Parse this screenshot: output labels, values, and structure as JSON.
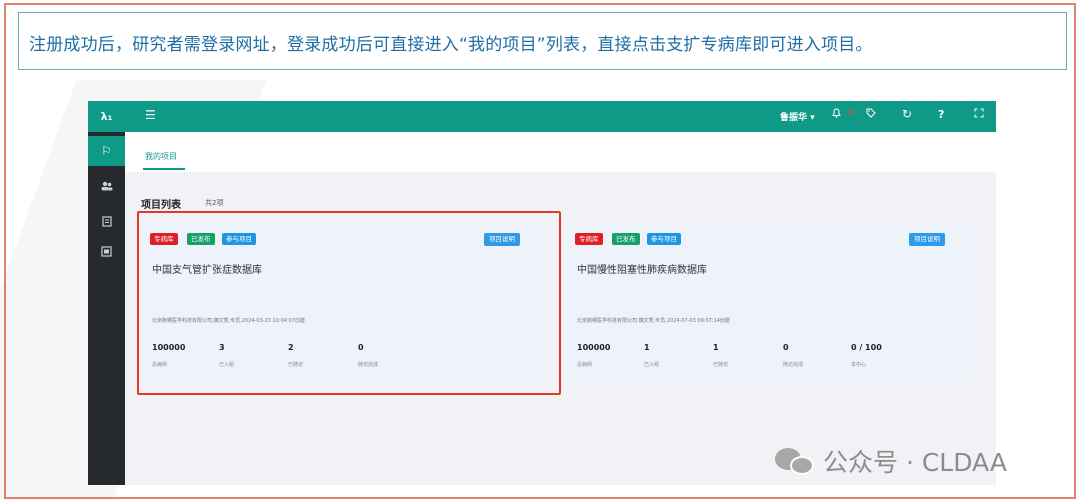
{
  "banner": {
    "text": "注册成功后，研究者需登录网址，登录成功后可直接进入“我的项目”列表，直接点击支扩专病库即可进入项目。"
  },
  "app": {
    "logo": "λ₁",
    "topbar": {
      "user_name": "鲁振华 ▾",
      "icons": [
        "menu-icon",
        "bell-icon",
        "tag-icon",
        "refresh-icon",
        "help-icon",
        "fullscreen-icon"
      ]
    },
    "sidebar": {
      "icons": [
        "flag-icon",
        "users-icon",
        "report-icon",
        "box-icon"
      ]
    },
    "tabs": [
      {
        "label": "我的项目"
      }
    ],
    "project_list": {
      "title": "项目列表",
      "count": "共2项"
    },
    "projects": [
      {
        "badges": [
          "专病库",
          "已发布",
          "参与项目"
        ],
        "desc_button": "项目说明",
        "title": "中国支气管扩张症数据库",
        "meta": "北京跑哪医学科技有限公司,魏文秀,专员,2024-03-23 10:04:07创建",
        "stats": [
          {
            "value": "100000",
            "label": "总病例"
          },
          {
            "value": "3",
            "label": "已入组"
          },
          {
            "value": "2",
            "label": "已随访"
          },
          {
            "value": "0",
            "label": "随访完成"
          }
        ]
      },
      {
        "badges": [
          "专病库",
          "已发布",
          "参与项目"
        ],
        "desc_button": "项目说明",
        "title": "中国慢性阻塞性肺疾病数据库",
        "meta": "北京跑哪医学科技有限公司,魏文秀,专员,2024-07-03 09:07:14创建",
        "stats": [
          {
            "value": "100000",
            "label": "总病例"
          },
          {
            "value": "1",
            "label": "已入组"
          },
          {
            "value": "1",
            "label": "已随访"
          },
          {
            "value": "0",
            "label": "随访完成"
          },
          {
            "value": "0 / 100",
            "label": "本中心"
          }
        ]
      }
    ]
  },
  "watermark": {
    "text": "公众号 · CLDAA"
  },
  "colors": {
    "accent": "#0e9a86",
    "highlight": "#e23a2a",
    "frame": "#e4836d",
    "banner_text": "#1d6fa5"
  }
}
